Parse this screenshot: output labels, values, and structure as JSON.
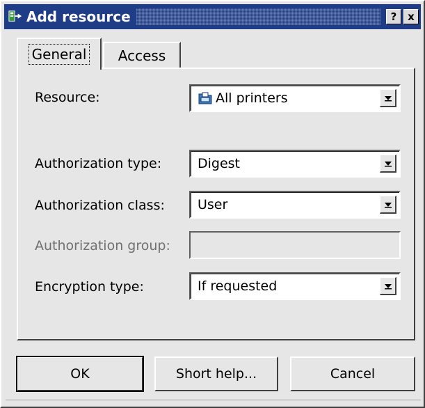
{
  "window": {
    "title": "Add resource",
    "help_button": "?",
    "close_button": "x"
  },
  "tabs": [
    {
      "label": "General",
      "active": true
    },
    {
      "label": "Access",
      "active": false
    }
  ],
  "form": {
    "resource": {
      "label": "Resource:",
      "value": "All printers",
      "icon": "printer-folder-icon"
    },
    "auth_type": {
      "label": "Authorization type:",
      "value": "Digest"
    },
    "auth_class": {
      "label": "Authorization class:",
      "value": "User"
    },
    "auth_group": {
      "label": "Authorization group:",
      "value": ""
    },
    "encryption": {
      "label": "Encryption type:",
      "value": "If requested"
    }
  },
  "buttons": {
    "ok": "OK",
    "help": "Short help...",
    "cancel": "Cancel"
  },
  "colors": {
    "titlebar": "#1f3d87",
    "background": "#e6e6e6"
  }
}
